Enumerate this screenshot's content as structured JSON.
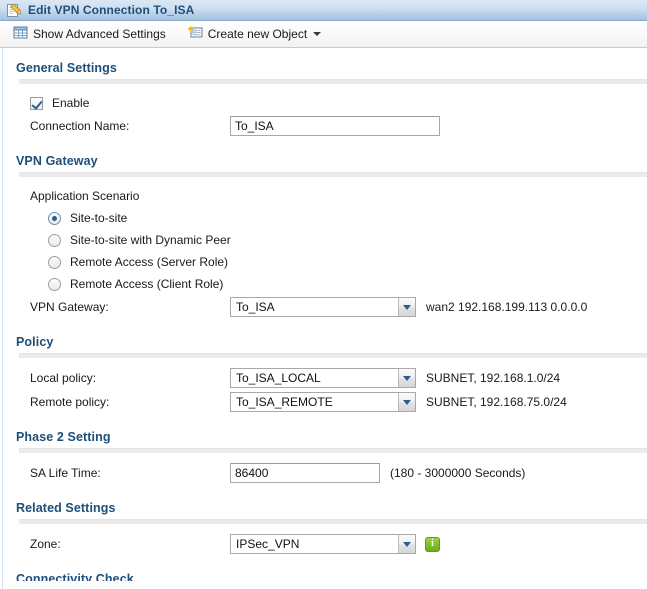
{
  "titlebar": {
    "icon": "edit-pencil-icon",
    "title": "Edit VPN Connection To_ISA"
  },
  "toolbar": {
    "show_advanced_label": "Show Advanced Settings",
    "show_advanced_icon": "table-grid-icon",
    "create_object_label": "Create new Object",
    "create_object_icon": "new-object-icon",
    "create_object_caret": "chevron-down-icon"
  },
  "sections": {
    "general": {
      "heading": "General Settings",
      "enable_label": "Enable",
      "enable_checked": true,
      "connection_name_label": "Connection Name:",
      "connection_name_value": "To_ISA",
      "connection_name_placeholder": ""
    },
    "vpn_gateway": {
      "heading": "VPN Gateway",
      "application_scenario_label": "Application Scenario",
      "scenarios": [
        {
          "label": "Site-to-site",
          "selected": true
        },
        {
          "label": "Site-to-site with Dynamic Peer",
          "selected": false
        },
        {
          "label": "Remote Access (Server Role)",
          "selected": false
        },
        {
          "label": "Remote Access (Client Role)",
          "selected": false
        }
      ],
      "gateway_label": "VPN Gateway:",
      "gateway_value": "To_ISA",
      "gateway_hint": "wan2 192.168.199.113 0.0.0.0"
    },
    "policy": {
      "heading": "Policy",
      "local_label": "Local policy:",
      "local_value": "To_ISA_LOCAL",
      "local_hint": "SUBNET, 192.168.1.0/24",
      "remote_label": "Remote policy:",
      "remote_value": "To_ISA_REMOTE",
      "remote_hint": "SUBNET, 192.168.75.0/24"
    },
    "phase2": {
      "heading": "Phase 2 Setting",
      "sa_life_label": "SA Life Time:",
      "sa_life_value": "86400",
      "sa_life_hint": "(180 - 3000000 Seconds)"
    },
    "related": {
      "heading": "Related Settings",
      "zone_label": "Zone:",
      "zone_value": "IPSec_VPN",
      "zone_info_icon": "info-icon"
    },
    "connectivity": {
      "heading": "Connectivity Check"
    }
  },
  "colors": {
    "heading": "#1f4e79",
    "titlebar_text": "#1f4e79",
    "accent_chevron": "#2c5d8f",
    "info_badge": "#7fc02a"
  }
}
